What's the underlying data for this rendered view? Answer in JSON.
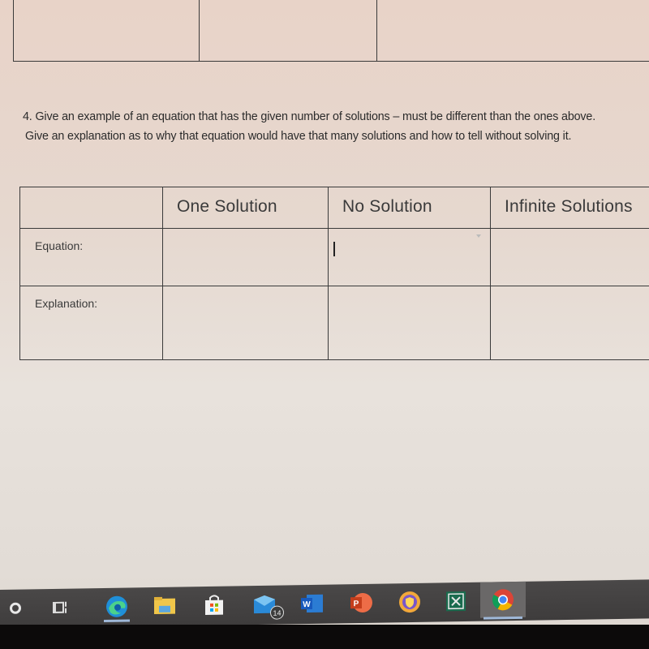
{
  "document": {
    "question": {
      "line1": "4. Give an example of an equation that has the given number of solutions – must be different than the ones above.",
      "line2": "Give an explanation as to why that equation would have that many solutions and how to tell without solving it."
    },
    "table": {
      "headers": [
        "",
        "One Solution",
        "No Solution",
        "Infinite Solutions"
      ],
      "rows": [
        {
          "label": "Equation:",
          "cells": [
            "",
            "",
            ""
          ]
        },
        {
          "label": "Explanation:",
          "cells": [
            "",
            "",
            ""
          ]
        }
      ]
    }
  },
  "taskbar": {
    "items": [
      {
        "name": "search",
        "icon": "search-icon"
      },
      {
        "name": "task-view",
        "icon": "task-view-icon"
      },
      {
        "name": "edge",
        "icon": "edge-icon",
        "running": true
      },
      {
        "name": "file-explorer",
        "icon": "folder-icon"
      },
      {
        "name": "store",
        "icon": "store-icon"
      },
      {
        "name": "mail",
        "icon": "mail-icon",
        "badge": "14"
      },
      {
        "name": "word",
        "icon": "word-icon",
        "letter": "W"
      },
      {
        "name": "powerpoint",
        "icon": "powerpoint-icon",
        "letter": "P"
      },
      {
        "name": "vpn",
        "icon": "shield-icon"
      },
      {
        "name": "app",
        "icon": "app-icon"
      },
      {
        "name": "chrome",
        "icon": "chrome-icon",
        "active": true
      }
    ]
  }
}
